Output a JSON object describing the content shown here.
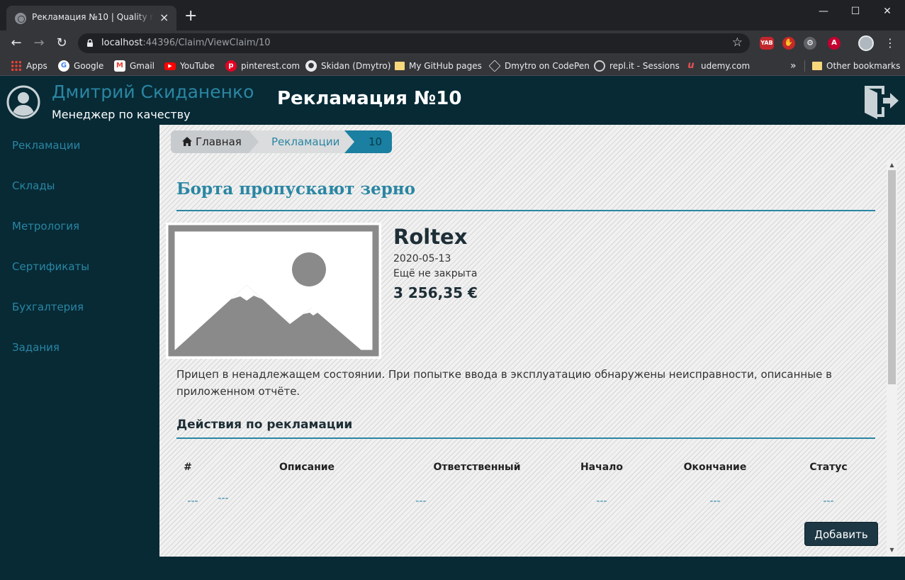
{
  "browser": {
    "tab_title": "Рекламация №10 | Quality management",
    "tab_close": "×",
    "new_tab": "+",
    "window_controls": {
      "minimize": "—",
      "maximize": "☐",
      "close": "✕"
    },
    "url_host": "localhost",
    "url_path": ":44396/Claim/ViewClaim/10",
    "extensions": [
      "YAB",
      "✋",
      "⚙",
      "A"
    ],
    "bookmarks": [
      {
        "label": "Apps",
        "icon": "apps-grid-icon",
        "color": "#e8453c"
      },
      {
        "label": "Google",
        "icon": "google-icon",
        "color": "#4285f4"
      },
      {
        "label": "Gmail",
        "icon": "gmail-icon",
        "color": "#ea4335"
      },
      {
        "label": "YouTube",
        "icon": "youtube-icon",
        "color": "#ff0000"
      },
      {
        "label": "pinterest.com",
        "icon": "pinterest-icon",
        "color": "#e60023"
      },
      {
        "label": "Skidan (Dmytro)",
        "icon": "github-icon",
        "color": "#ffffff"
      },
      {
        "label": "My GitHub pages",
        "icon": "folder-icon",
        "color": "#f6d77c"
      },
      {
        "label": "Dmytro on CodePen",
        "icon": "codepen-icon",
        "color": "#ffffff"
      },
      {
        "label": "repl.it - Sessions",
        "icon": "replit-icon",
        "color": "#cccccc"
      },
      {
        "label": "udemy.com",
        "icon": "udemy-icon",
        "color": "#ec5252"
      }
    ],
    "more_bookmarks": "»",
    "other_bookmarks": "Other bookmarks"
  },
  "app": {
    "user_name": "Дмитрий Скиданенко",
    "user_role": "Менеджер по качеству",
    "page_heading": "Рекламация №10",
    "accent_color": "#2a86a3",
    "header_bg": "#072a35",
    "sidebar": [
      "Рекламации",
      "Склады",
      "Метрология",
      "Сертификаты",
      "Бухгалтерия",
      "Задания"
    ],
    "breadcrumb": {
      "home": "Главная",
      "claims": "Рекламации",
      "current": "10"
    }
  },
  "claim": {
    "title": "Борта пропускают зерно",
    "company": "Roltex",
    "date": "2020-05-13",
    "status": "Ещё не закрыта",
    "amount": "3 256,35 €",
    "description": "Прицеп в ненадлежащем состоянии. При попытке ввода в эксплуатацию обнаружены неисправности, описанные в приложенном отчёте."
  },
  "actions": {
    "title": "Действия по рекламации",
    "columns": [
      "#",
      "Описание",
      "Ответственный",
      "Начало",
      "Окончание",
      "Статус"
    ],
    "row": [
      "---",
      "---",
      "---",
      "---",
      "---",
      "---"
    ],
    "add_label": "Добавить"
  }
}
